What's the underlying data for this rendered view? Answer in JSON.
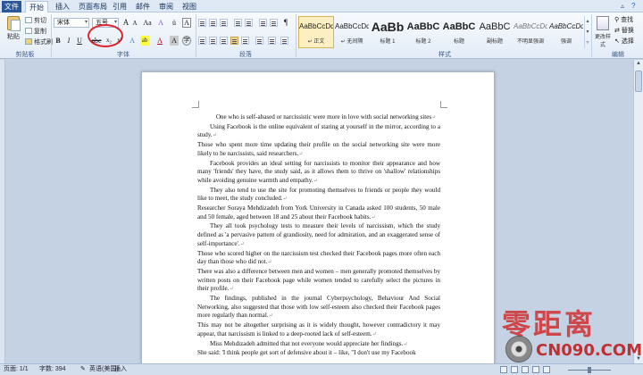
{
  "menu": {
    "tabs": [
      "文件",
      "开始",
      "插入",
      "页面布局",
      "引用",
      "邮件",
      "审阅",
      "视图"
    ],
    "active": "开始"
  },
  "ribbon": {
    "clipboard": {
      "paste": "粘贴",
      "cut": "剪切",
      "copy": "复制",
      "format_painter": "格式刷",
      "label": "剪贴板"
    },
    "font": {
      "name": "宋体",
      "size": "五号",
      "label": "字体"
    },
    "paragraph": {
      "label": "段落"
    },
    "styles": {
      "label": "样式",
      "items": [
        {
          "sample": "AaBbCcDd",
          "name": "↵ 正文"
        },
        {
          "sample": "AaBbCcDd",
          "name": "↵ 无间隔"
        },
        {
          "sample": "AaBb",
          "name": "标题 1"
        },
        {
          "sample": "AaBbC",
          "name": "标题 2"
        },
        {
          "sample": "AaBbC",
          "name": "标题"
        },
        {
          "sample": "AaBbC",
          "name": "副标题"
        },
        {
          "sample": "AaBbCcDd",
          "name": "不明显强调"
        },
        {
          "sample": "AaBbCcDd",
          "name": "强调"
        }
      ],
      "change": "更改样式"
    },
    "editing": {
      "find": "查找",
      "replace": "替换",
      "select": "选择",
      "label": "编辑"
    }
  },
  "document": {
    "title": "One who is self-abased or narcissistic were more in love with social networking sites",
    "paragraphs": [
      {
        "indent": true,
        "text": "Using Facebook is the online equivalent of staring at yourself in the mirror, according to a study."
      },
      {
        "indent": false,
        "text": "Those who spent more time updating their profile on the social networking site were more likely to be narcissists, said researchers."
      },
      {
        "indent": true,
        "text": "Facebook provides an ideal setting for narcissists to monitor their appearance and how many 'friends' they have, the study said, as it allows them to thrive on 'shallow' relationships while avoiding genuine warmth and empathy."
      },
      {
        "indent": true,
        "text": "They also tend to use the site for promoting themselves to friends or people they would like to meet, the study concluded."
      },
      {
        "indent": false,
        "text": "Researcher Soraya Mehdizadeh from York University in Canada asked 100 students, 50 male and 50 female, aged between 18 and 25 about their Facebook habits."
      },
      {
        "indent": true,
        "text": "They all took psychology tests to measure their levels of narcissism, which the study defined as 'a pervasive pattern of grandiosity, need for admiration, and an exaggerated sense of self-importance'."
      },
      {
        "indent": false,
        "text": "Those who scored higher on the narcissism test checked their Facebook pages more often each day than those who did not."
      },
      {
        "indent": false,
        "text": "There was also a difference between men and women – men generally promoted themselves by written posts on their Facebook page while women tended to carefully select the pictures in their profile."
      },
      {
        "indent": true,
        "text": "The findings, published in the journal Cyberpsychology, Behaviour And Social Networking, also suggested that those with low self-esteem also checked their Facebook pages more regularly than normal."
      },
      {
        "indent": false,
        "text": "This may not be altogether surprising as it is widely thought, however contradictory it may appear, that narcissism is linked to a deep-rooted lack of self-esteem."
      },
      {
        "indent": true,
        "text": "Miss Mehdizadeh admitted that not everyone would appreciate her findings."
      },
      {
        "indent": false,
        "text": "She said: 'I think people get sort of defensive about it – like, \"I don't use my Facebook"
      }
    ]
  },
  "status": {
    "page": "页面: 1/1",
    "words": "字数: 394",
    "lang": "英语(美国)",
    "mode": "插入"
  },
  "watermark": {
    "logo": "零距离",
    "url": "CN090.COM"
  },
  "colors": {
    "file_tab": "#2b579a",
    "annotation": "#e0242b",
    "watermark": "#d02828"
  }
}
